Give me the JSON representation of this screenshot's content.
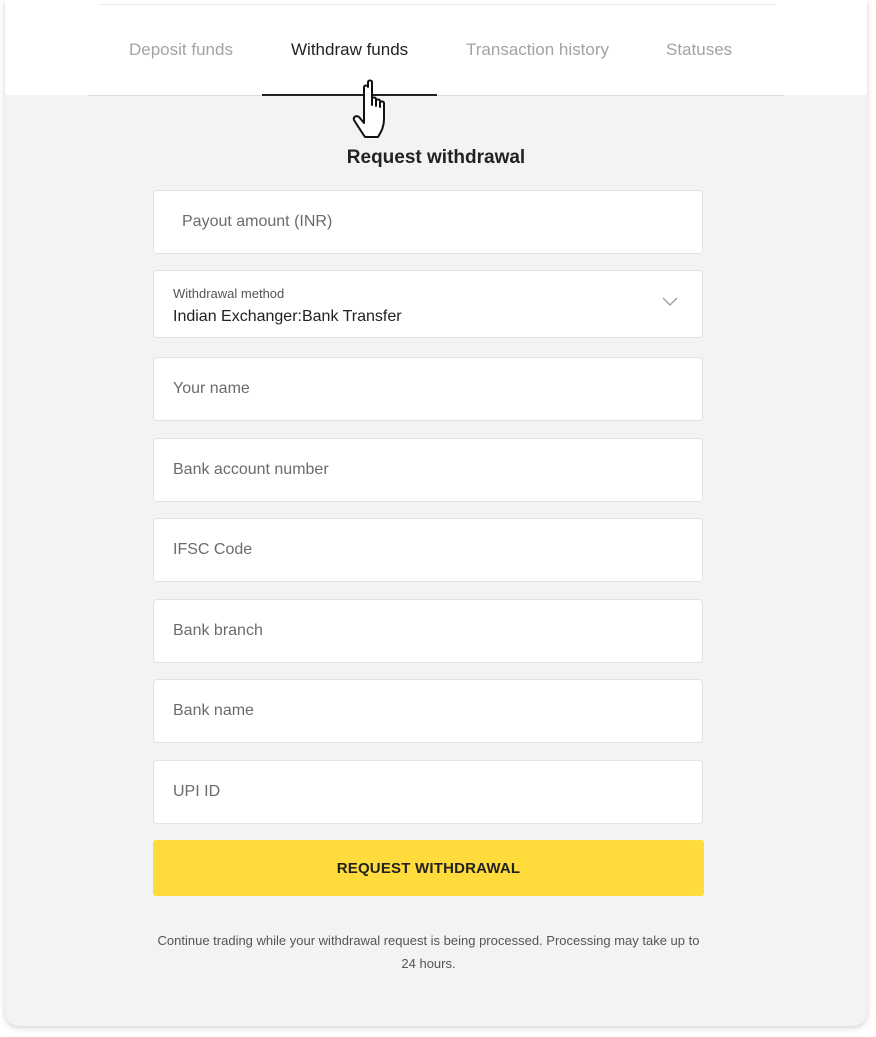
{
  "tabs": [
    {
      "label": "Deposit funds",
      "active": false
    },
    {
      "label": "Withdraw funds",
      "active": true
    },
    {
      "label": "Transaction history",
      "active": false
    },
    {
      "label": "Statuses",
      "active": false
    }
  ],
  "form": {
    "title": "Request withdrawal",
    "amount_placeholder": "Payout amount (INR)",
    "method": {
      "label": "Withdrawal method",
      "value": "Indian Exchanger:Bank Transfer",
      "icon": "chevron-down-icon"
    },
    "fields": {
      "name": "Your name",
      "account": "Bank account number",
      "ifsc": "IFSC Code",
      "branch": "Bank branch",
      "bank_name": "Bank name",
      "upi": "UPI ID"
    },
    "submit_label": "REQUEST WITHDRAWAL",
    "note": "Continue trading while your withdrawal request is being processed.  Processing may take up to 24 hours."
  },
  "colors": {
    "accent": "#ffdc3b",
    "panel": "#f3f3f3",
    "active_tab": "#222222",
    "inactive_tab": "#a3a3a3"
  },
  "cursor_icon": "hand-pointer-icon"
}
